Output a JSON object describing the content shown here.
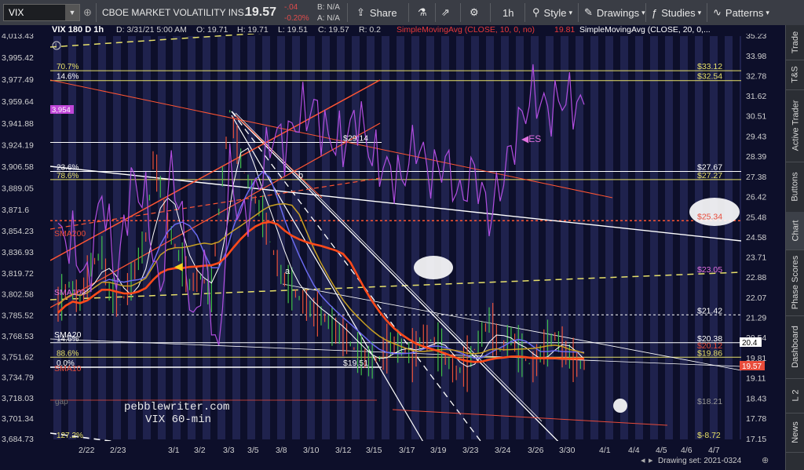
{
  "toolbar": {
    "symbol": "VIX",
    "description": "CBOE MARKET VOLATILITY INS...",
    "last": "19.57",
    "change": "-.04",
    "change_pct": "-0.20%",
    "bid": "B: N/A",
    "ask": "A: N/A",
    "share": "Share",
    "interval": "1h",
    "style": "Style",
    "drawings": "Drawings",
    "studies": "Studies",
    "patterns": "Patterns"
  },
  "sidebar": {
    "tabs": [
      "Trade",
      "T&S",
      "Active Trader",
      "Buttons",
      "Chart",
      "Phase Scores",
      "Dashboard",
      "L 2",
      "News"
    ]
  },
  "header": {
    "title": "VIX 180 D 1h",
    "date": "D: 3/31/21 5:00 AM",
    "open": "O: 19.71",
    "high": "H: 19.71",
    "low": "L: 19.51",
    "close": "C: 19.57",
    "range": "R: 0.2",
    "sma10": "SimpleMovingAvg (CLOSE, 10, 0, no)",
    "sma10_val": "19.81",
    "sma20": "SimpleMovingAvg (CLOSE, 20, 0,..."
  },
  "chart_data": {
    "type": "line",
    "title": "VIX 60-min",
    "x_ticks": [
      "2/22",
      "2/23",
      "3/1",
      "3/2",
      "3/3",
      "3/5",
      "3/8",
      "3/10",
      "3/12",
      "3/15",
      "3/17",
      "3/19",
      "3/23",
      "3/24",
      "3/26",
      "3/30",
      "4/1",
      "4/4",
      "4/5",
      "4/6",
      "4/7"
    ],
    "y_ticks_right": [
      "35.23",
      "33.98",
      "32.78",
      "31.62",
      "30.51",
      "29.43",
      "28.39",
      "27.38",
      "26.42",
      "25.48",
      "24.58",
      "23.71",
      "22.88",
      "22.07",
      "21.29",
      "20.54",
      "19.81",
      "19.11",
      "18.43",
      "17.78",
      "17.15"
    ],
    "y_ticks_left_es": [
      "4,013.43",
      "3,995.42",
      "3,977.49",
      "3,959.64",
      "3,941.88",
      "3,924.19",
      "3,906.58",
      "3,889.05",
      "3,871.6",
      "3,854.23",
      "3,836.93",
      "3,819.72",
      "3,802.58",
      "3,785.52",
      "3,768.53",
      "3,751.62",
      "3,734.79",
      "3,718.03",
      "3,701.34",
      "3,684.73"
    ],
    "ylim": [
      17.15,
      35.23
    ],
    "log_scale": true,
    "es_price_label": "3,954",
    "series": [
      {
        "name": "VIX",
        "color": "#f08030",
        "values": [
          [
            0,
            21.8
          ],
          [
            3,
            22.6
          ],
          [
            6,
            21.9
          ],
          [
            9,
            23.4
          ],
          [
            12,
            23.9
          ],
          [
            14,
            22.3
          ],
          [
            17,
            21.8
          ],
          [
            20,
            22.7
          ],
          [
            24,
            24.6
          ],
          [
            26,
            28.2
          ],
          [
            28,
            26.9
          ],
          [
            30,
            25.1
          ],
          [
            33,
            23.8
          ],
          [
            36,
            22.6
          ],
          [
            39,
            22.9
          ],
          [
            42,
            22.4
          ],
          [
            45,
            27.4
          ],
          [
            47,
            30.8
          ],
          [
            49,
            29.0
          ],
          [
            51,
            27.6
          ],
          [
            54,
            26.3
          ],
          [
            56,
            25.5
          ],
          [
            58,
            24.4
          ],
          [
            61,
            23.0
          ],
          [
            64,
            22.4
          ],
          [
            67,
            21.9
          ],
          [
            70,
            21.5
          ],
          [
            73,
            21.3
          ],
          [
            76,
            20.8
          ],
          [
            79,
            20.5
          ],
          [
            82,
            20.0
          ],
          [
            85,
            19.7
          ],
          [
            88,
            19.8
          ],
          [
            91,
            20.3
          ],
          [
            94,
            20.2
          ],
          [
            97,
            19.9
          ],
          [
            100,
            20.6
          ],
          [
            103,
            20.4
          ],
          [
            106,
            19.8
          ],
          [
            109,
            19.3
          ],
          [
            112,
            19.6
          ],
          [
            115,
            20.4
          ],
          [
            118,
            21.2
          ],
          [
            121,
            20.1
          ],
          [
            124,
            20.6
          ],
          [
            127,
            19.9
          ],
          [
            130,
            19.5
          ],
          [
            133,
            20.2
          ],
          [
            136,
            20.6
          ],
          [
            139,
            20.0
          ],
          [
            142,
            19.6
          ],
          [
            144,
            19.57
          ]
        ]
      },
      {
        "name": "ES",
        "color": "#b04ee0",
        "values": [
          [
            0,
            3852
          ],
          [
            4,
            3845
          ],
          [
            8,
            3812
          ],
          [
            12,
            3888
          ],
          [
            16,
            3815
          ],
          [
            20,
            3895
          ],
          [
            24,
            3880
          ],
          [
            28,
            3798
          ],
          [
            31,
            3910
          ],
          [
            34,
            3860
          ],
          [
            37,
            3772
          ],
          [
            40,
            3830
          ],
          [
            44,
            3747
          ],
          [
            47,
            3905
          ],
          [
            50,
            3862
          ],
          [
            53,
            3878
          ],
          [
            56,
            3905
          ],
          [
            59,
            3935
          ],
          [
            62,
            3925
          ],
          [
            66,
            3948
          ],
          [
            70,
            3955
          ],
          [
            74,
            3930
          ],
          [
            78,
            3925
          ],
          [
            82,
            3950
          ],
          [
            86,
            3915
          ],
          [
            90,
            3905
          ],
          [
            94,
            3895
          ],
          [
            98,
            3928
          ],
          [
            102,
            3900
          ],
          [
            106,
            3912
          ],
          [
            110,
            3880
          ],
          [
            114,
            3905
          ],
          [
            118,
            3865
          ],
          [
            122,
            3900
          ],
          [
            126,
            3940
          ],
          [
            130,
            3968
          ],
          [
            134,
            3952
          ],
          [
            138,
            3963
          ],
          [
            142,
            3958
          ],
          [
            144,
            3954
          ]
        ]
      }
    ],
    "studies": [
      "SMA10",
      "SMA20",
      "SMA100",
      "SMA200"
    ],
    "levels": [
      {
        "label": "$33.12",
        "value": 33.12,
        "fib": "70.7%"
      },
      {
        "label": "$32.54",
        "value": 32.54,
        "fib": "14.6%"
      },
      {
        "label": "$29:14",
        "value": 29.14
      },
      {
        "label": "$27.67",
        "value": 27.67,
        "fib": "23.6%"
      },
      {
        "label": "$27.27",
        "value": 27.27,
        "fib": "78.6%"
      },
      {
        "label": "$25.34",
        "value": 25.34
      },
      {
        "label": "$23.05",
        "value": 23.05
      },
      {
        "label": "$21.42",
        "value": 21.42
      },
      {
        "label": "$20.38",
        "value": 20.38,
        "fib": "14.6%"
      },
      {
        "label": "$20.12",
        "value": 20.12
      },
      {
        "label": "$19.86",
        "value": 19.86,
        "fib": "88.6%"
      },
      {
        "label": "$19.51",
        "value": 19.51,
        "fib": "0.0%"
      },
      {
        "label": "$18.21",
        "value": 18.21
      },
      {
        "label": "$-8.72",
        "value": 17.15,
        "fib": "127.2%"
      }
    ],
    "markers": [
      "ES",
      "a",
      "b",
      "gap"
    ],
    "sma_labels": [
      "SMA200",
      "SMA100",
      "SMA20",
      "SMA10"
    ],
    "watermark": [
      "pebblewriter.com",
      "VIX 60-min"
    ],
    "last_price_label": "19.57",
    "last_es_label": "20.4",
    "drawing_set": "Drawing set: 2021-0324"
  }
}
